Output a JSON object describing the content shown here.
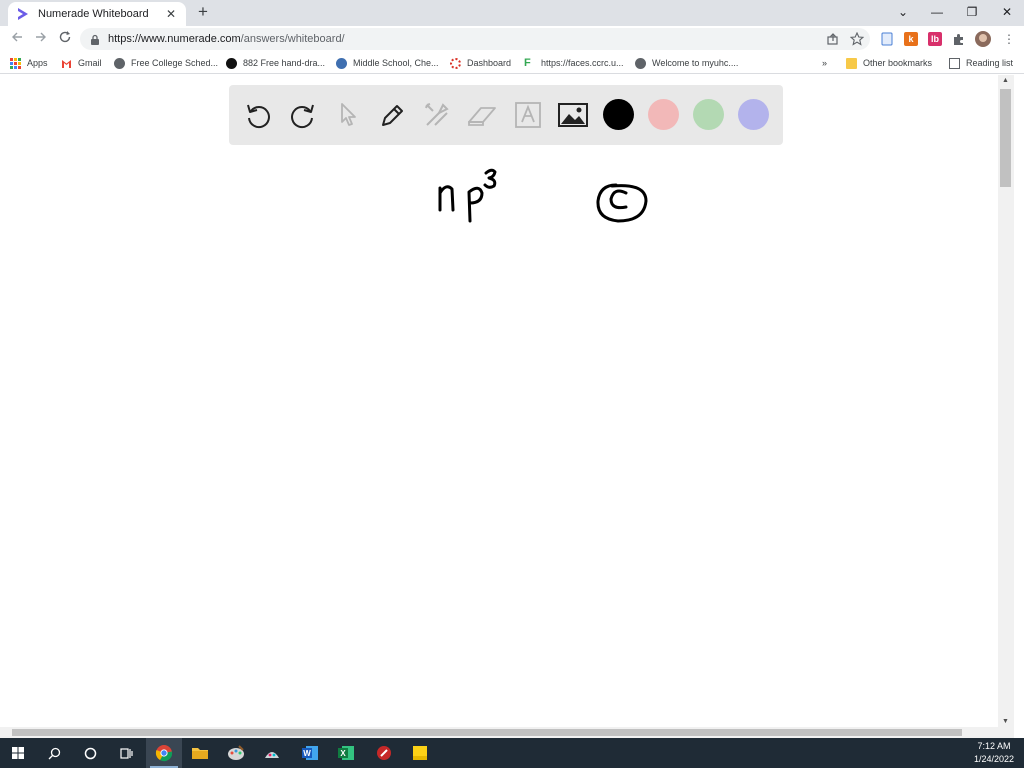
{
  "browser": {
    "tab_title": "Numerade Whiteboard",
    "tab_close": "✕",
    "new_tab": "+",
    "url_host": "https://www.numerade.com",
    "url_path": "/answers/whiteboard/",
    "window_controls": {
      "minimize": "—",
      "maximize": "❐",
      "close": "✕",
      "tab_search": "⌄"
    },
    "extensions": {
      "k": "k",
      "lb": "lb"
    }
  },
  "bookmarks": {
    "items": [
      {
        "label": "Apps"
      },
      {
        "label": "Gmail"
      },
      {
        "label": "Free College Sched..."
      },
      {
        "label": "882 Free hand-dra..."
      },
      {
        "label": "Middle School, Che..."
      },
      {
        "label": "Dashboard"
      },
      {
        "label": "https://faces.ccrc.u..."
      },
      {
        "label": "Welcome to myuhc...."
      }
    ],
    "overflow": "»",
    "other": "Other bookmarks",
    "reading_list": "Reading list"
  },
  "whiteboard": {
    "tools": [
      "undo-icon",
      "redo-icon",
      "pointer-icon",
      "pen-icon",
      "tools-icon",
      "eraser-icon",
      "text-icon",
      "image-icon"
    ],
    "colors": [
      "#000000",
      "#f2b8b8",
      "#b3d9b3",
      "#b3b3ec"
    ],
    "selected_color": "#000000"
  },
  "taskbar": {
    "time": "7:12 AM",
    "date": "1/24/2022"
  }
}
